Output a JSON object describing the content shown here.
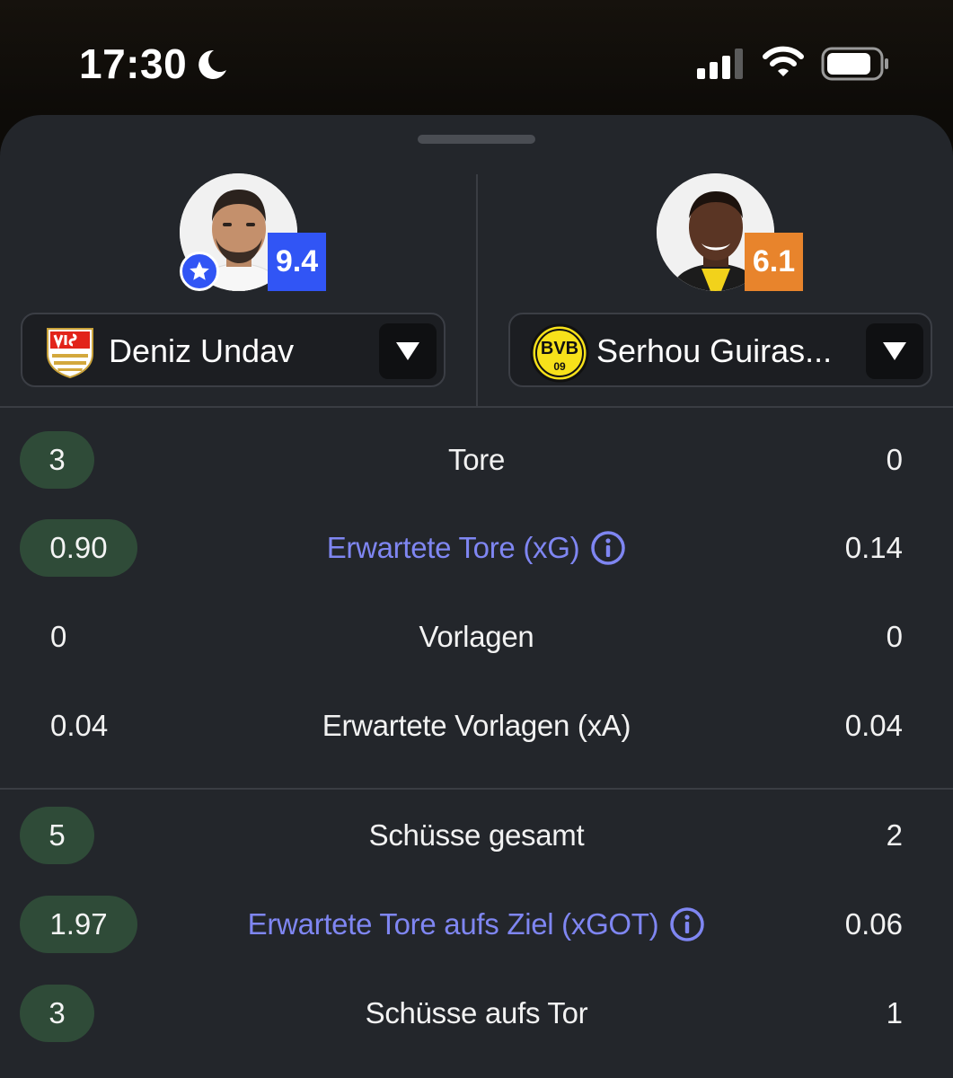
{
  "status_bar": {
    "time": "17:30",
    "icons": [
      "moon-icon",
      "signal-icon",
      "wifi-icon",
      "battery-icon"
    ]
  },
  "players": {
    "left": {
      "name": "Deniz Undav",
      "rating": "9.4",
      "rating_color": "#3155f5",
      "club_crest": "vfb-stuttgart-crest",
      "badge": "star-icon"
    },
    "right": {
      "name": "Serhou Guiras...",
      "rating": "6.1",
      "rating_color": "#e8842c",
      "club_crest": "bvb-crest",
      "club_crest_text": "BVB 09"
    }
  },
  "stats": {
    "group1": [
      {
        "label": "Tore",
        "left": "3",
        "right": "0",
        "highlight": "left"
      },
      {
        "label": "Erwartete Tore (xG)",
        "left": "0.90",
        "right": "0.14",
        "highlight": "left",
        "info": true
      },
      {
        "label": "Vorlagen",
        "left": "0",
        "right": "0",
        "highlight": "none"
      },
      {
        "label": "Erwartete Vorlagen (xA)",
        "left": "0.04",
        "right": "0.04",
        "highlight": "none"
      }
    ],
    "group2": [
      {
        "label": "Schüsse gesamt",
        "left": "5",
        "right": "2",
        "highlight": "left"
      },
      {
        "label": "Erwartete Tore aufs Ziel (xGOT)",
        "left": "1.97",
        "right": "0.06",
        "highlight": "left",
        "info": true
      },
      {
        "label": "Schüsse aufs Tor",
        "left": "3",
        "right": "1",
        "highlight": "left"
      }
    ]
  },
  "colors": {
    "sheet_bg": "#23262b",
    "highlight_pill": "#2f4b38",
    "link_text": "#7f86f2"
  }
}
